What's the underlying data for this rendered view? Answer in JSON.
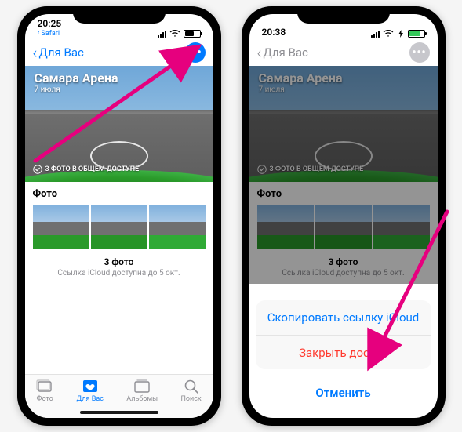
{
  "left": {
    "status": {
      "time": "20:25",
      "sub": "Safari",
      "battery_color": "black"
    },
    "nav": {
      "back_label": "Для Вас",
      "more_glyph": "•••"
    },
    "hero": {
      "title": "Самара Арена",
      "subtitle": "7 июля",
      "badge_label": "3 ФОТО В ОБЩЕМ ДОСТУПЕ"
    },
    "photos": {
      "heading": "Фото",
      "count_label": "3 фото",
      "expires_label": "Ссылка iCloud доступна до 5 окт."
    },
    "tabs": [
      {
        "label": "Фото",
        "active": false
      },
      {
        "label": "Для Вас",
        "active": true
      },
      {
        "label": "Альбомы",
        "active": false
      },
      {
        "label": "Поиск",
        "active": false
      }
    ]
  },
  "right": {
    "status": {
      "time": "20:38",
      "battery_color": "green"
    },
    "nav": {
      "back_label": "Для Вас",
      "more_glyph": "•••"
    },
    "hero": {
      "title": "Самара Арена",
      "subtitle": "7 июля",
      "badge_label": "3 ФОТО В ОБЩЕМ ДОСТУПЕ"
    },
    "photos": {
      "heading": "Фото",
      "count_label": "3 фото",
      "expires_label": "Ссылка iCloud доступна до 5 окт."
    },
    "sheet": {
      "copy_label": "Скопировать ссылку iCloud",
      "stop_label": "Закрыть доступ",
      "cancel_label": "Отменить"
    }
  }
}
